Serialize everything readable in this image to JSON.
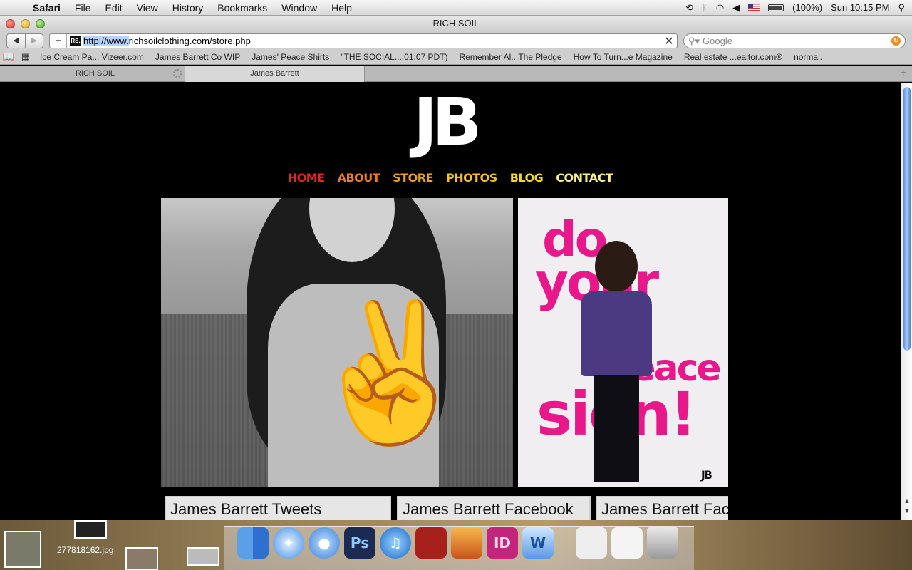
{
  "menubar": {
    "app": "Safari",
    "menus": [
      "File",
      "Edit",
      "View",
      "History",
      "Bookmarks",
      "Window",
      "Help"
    ],
    "battery": "(100%)",
    "clock": "Sun 10:15 PM"
  },
  "window": {
    "title": "RICH SOIL"
  },
  "toolbar": {
    "favicon_text": "RS.",
    "url_selected": "http://www.",
    "url_rest": "richsoilclothing.com/store.php",
    "search_placeholder": "Google"
  },
  "bookmarks": [
    "Ice Cream Pa... Vizeer.com",
    "James Barrett Co WIP",
    "James' Peace Shirts",
    "\"THE SOCIAL...:01:07 PDT)",
    "Remember Al...The Pledge",
    "How To Turn...e Magazine",
    "Real estate ...ealtor.com®",
    "normal."
  ],
  "tabs": [
    {
      "label": "RICH SOIL"
    },
    {
      "label": "James Barrett"
    }
  ],
  "site": {
    "logo": "JB",
    "nav": [
      {
        "label": "HOME",
        "color": "#e8231e"
      },
      {
        "label": "ABOUT",
        "color": "#f07a1e"
      },
      {
        "label": "STORE",
        "color": "#f2a01e"
      },
      {
        "label": "PHOTOS",
        "color": "#f5c31c"
      },
      {
        "label": "BLOG",
        "color": "#f7dc1a"
      },
      {
        "label": "CONTACT",
        "color": "#f8f08a"
      }
    ],
    "poster": {
      "line1": "do",
      "line2": "your",
      "line3": "peace",
      "line4": "sign!",
      "mark": "JB",
      "color": "#e8178a"
    },
    "widgets": [
      "James Barrett Tweets",
      "James Barrett Facebook",
      "James Barrett Facebook"
    ]
  },
  "desktop": {
    "file_label": "277818162.jpg"
  },
  "dock": {
    "icons": [
      {
        "name": "finder-icon",
        "label": ""
      },
      {
        "name": "safari-icon",
        "label": ""
      },
      {
        "name": "ichat-icon",
        "label": ""
      },
      {
        "name": "photoshop-icon",
        "label": "Ps"
      },
      {
        "name": "itunes-icon",
        "label": ""
      },
      {
        "name": "photo-booth-icon",
        "label": ""
      },
      {
        "name": "iphoto-icon",
        "label": ""
      },
      {
        "name": "indesign-icon",
        "label": "ID"
      },
      {
        "name": "word-icon",
        "label": "W"
      },
      {
        "name": "indesign-doc-icon",
        "label": ""
      },
      {
        "name": "photoshop-doc-icon",
        "label": ""
      },
      {
        "name": "trash-icon",
        "label": ""
      }
    ]
  }
}
